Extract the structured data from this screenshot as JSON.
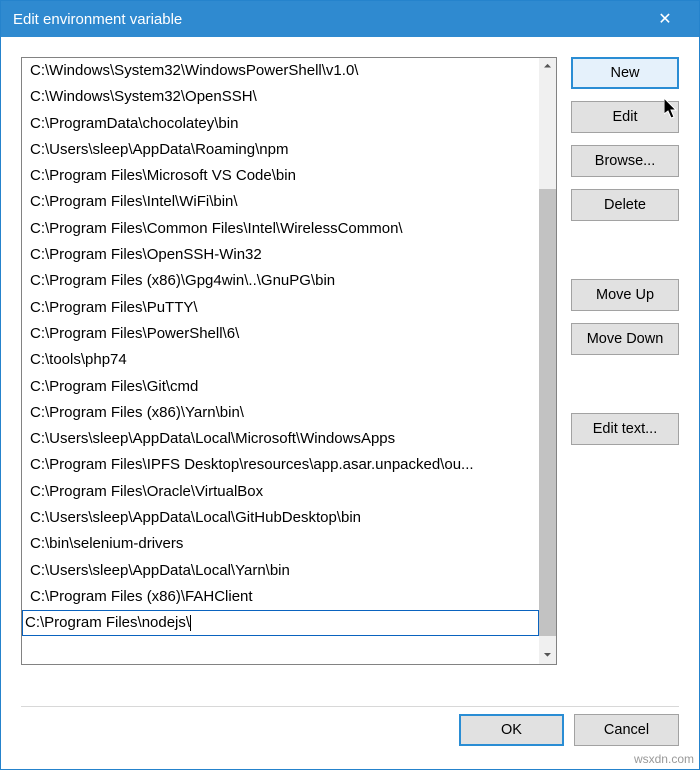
{
  "window": {
    "title": "Edit environment variable",
    "close_icon": "✕"
  },
  "paths": [
    "C:\\Windows\\System32\\WindowsPowerShell\\v1.0\\",
    "C:\\Windows\\System32\\OpenSSH\\",
    "C:\\ProgramData\\chocolatey\\bin",
    "C:\\Users\\sleep\\AppData\\Roaming\\npm",
    "C:\\Program Files\\Microsoft VS Code\\bin",
    "C:\\Program Files\\Intel\\WiFi\\bin\\",
    "C:\\Program Files\\Common Files\\Intel\\WirelessCommon\\",
    "C:\\Program Files\\OpenSSH-Win32",
    "C:\\Program Files (x86)\\Gpg4win\\..\\GnuPG\\bin",
    "C:\\Program Files\\PuTTY\\",
    "C:\\Program Files\\PowerShell\\6\\",
    "C:\\tools\\php74",
    "C:\\Program Files\\Git\\cmd",
    "C:\\Program Files (x86)\\Yarn\\bin\\",
    "C:\\Users\\sleep\\AppData\\Local\\Microsoft\\WindowsApps",
    "C:\\Program Files\\IPFS Desktop\\resources\\app.asar.unpacked\\ou...",
    "C:\\Program Files\\Oracle\\VirtualBox",
    "C:\\Users\\sleep\\AppData\\Local\\GitHubDesktop\\bin",
    "C:\\bin\\selenium-drivers",
    "C:\\Users\\sleep\\AppData\\Local\\Yarn\\bin",
    "C:\\Program Files (x86)\\FAHClient",
    "C:\\Program Files\\nodejs\\"
  ],
  "selected_index": 21,
  "editing_value": "C:\\Program Files\\nodejs\\",
  "buttons": {
    "new": "New",
    "edit": "Edit",
    "browse": "Browse...",
    "delete": "Delete",
    "move_up": "Move Up",
    "move_down": "Move Down",
    "edit_text": "Edit text...",
    "ok": "OK",
    "cancel": "Cancel"
  },
  "scroll": {
    "up": "⏶",
    "down": "⏷"
  },
  "watermark": "wsxdn.com"
}
